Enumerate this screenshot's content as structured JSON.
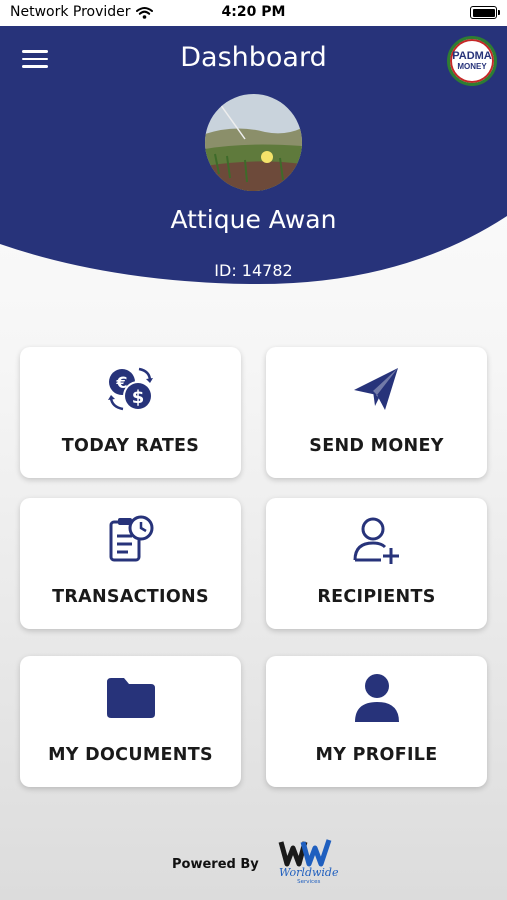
{
  "status_bar": {
    "carrier": "Network Provider",
    "time": "4:20 PM"
  },
  "header": {
    "title": "Dashboard",
    "brand_line1": "PADMA",
    "brand_line2": "MONEY"
  },
  "user": {
    "name": "Attique Awan",
    "id_text": "ID: 14782"
  },
  "tiles": [
    {
      "label": "TODAY RATES",
      "icon": "currency-exchange-icon"
    },
    {
      "label": "SEND MONEY",
      "icon": "paper-plane-icon"
    },
    {
      "label": "TRANSACTIONS",
      "icon": "clipboard-clock-icon"
    },
    {
      "label": "RECIPIENTS",
      "icon": "add-user-icon"
    },
    {
      "label": "MY DOCUMENTS",
      "icon": "folder-icon"
    },
    {
      "label": "MY PROFILE",
      "icon": "user-icon"
    }
  ],
  "footer": {
    "powered_by": "Powered By",
    "logo_word": "Worldwide",
    "logo_sub": "Services"
  },
  "colors": {
    "primary": "#27337a",
    "accent_green": "#2e7d32",
    "accent_red": "#c62828",
    "logo_blue": "#1f5fbf"
  }
}
